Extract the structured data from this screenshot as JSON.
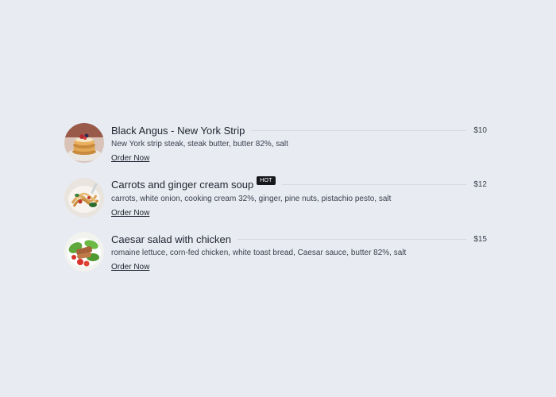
{
  "menu": {
    "items": [
      {
        "name": "Black Angus - New York Strip",
        "badge": "",
        "price": "$10",
        "ingredients": "New York strip steak, steak butter, butter 82%, salt",
        "cta": "Order Now",
        "image": "pancake-stack-photo"
      },
      {
        "name": "Carrots and ginger cream soup",
        "badge": "HOT",
        "price": "$12",
        "ingredients": "carrots, white onion, cooking cream 32%, ginger, pine nuts, pistachio pesto, salt",
        "cta": "Order Now",
        "image": "pasta-dish-photo"
      },
      {
        "name": "Caesar salad with chicken",
        "badge": "",
        "price": "$15",
        "ingredients": "romaine lettuce, corn-fed chicken, white toast bread, Caesar sauce, butter 82%, salt",
        "cta": "Order Now",
        "image": "salad-dish-photo"
      }
    ]
  },
  "colors": {
    "background": "#e8ebf1",
    "text": "#1e2330",
    "muted": "#3b4150",
    "badge_bg": "#16181d",
    "leader": "#d4d8e0"
  }
}
